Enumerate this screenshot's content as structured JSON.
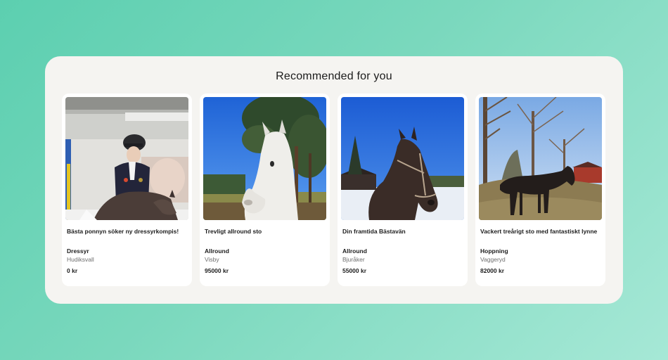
{
  "section": {
    "title": "Recommended for you"
  },
  "listings": [
    {
      "title": "Bästa ponnyn söker ny dressyrkompis!",
      "category": "Dressyr",
      "location": "Hudiksvall",
      "price": "0 kr",
      "image": "rider-on-dark-pony-indoor-arena-photo"
    },
    {
      "title": "Trevligt allround sto",
      "category": "Allround",
      "location": "Visby",
      "price": "95000 kr",
      "image": "white-horse-head-blue-sky-photo"
    },
    {
      "title": "Din framtida Bästavän",
      "category": "Allround",
      "location": "Bjuråker",
      "price": "55000 kr",
      "image": "dark-horse-with-halter-snow-photo"
    },
    {
      "title": "Vackert treårigt sto med fantastiskt lynne",
      "category": "Hoppning",
      "location": "Vaggeryd",
      "price": "82000 kr",
      "image": "black-horse-in-field-photo"
    }
  ]
}
